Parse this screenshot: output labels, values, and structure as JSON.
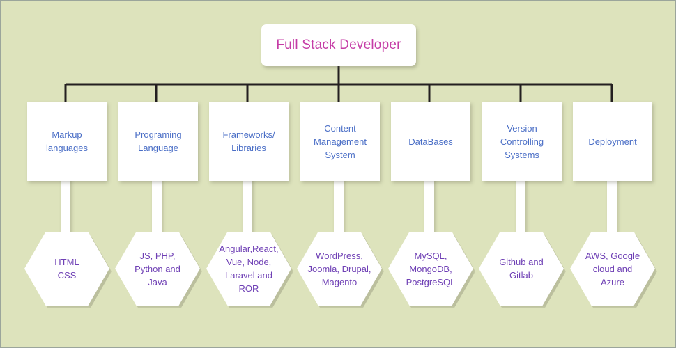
{
  "diagram": {
    "title": "Full Stack Developer",
    "background_color": "#dde3bc",
    "border_color": "#9ba59b",
    "node_fill": "#ffffff",
    "root_text_color": "#c53ca6",
    "category_text_color": "#4a6ec6",
    "leaf_text_color": "#6f40b5",
    "connector_color": "#231f20"
  },
  "root": {
    "label": "Full Stack Developer"
  },
  "categories": [
    {
      "label": "Markup\nlanguages",
      "leaf": "HTML\nCSS"
    },
    {
      "label": "Programing\nLanguage",
      "leaf": "JS, PHP,\nPython and\nJava"
    },
    {
      "label": "Frameworks/\nLibraries",
      "leaf": "Angular,React,\nVue, Node,\nLaravel and\nROR"
    },
    {
      "label": "Content\nManagement\nSystem",
      "leaf": "WordPress,\nJoomla, Drupal,\nMagento"
    },
    {
      "label": "DataBases",
      "leaf": "MySQL,\nMongoDB,\nPostgreSQL"
    },
    {
      "label": "Version\nControlling\nSystems",
      "leaf": "Github and\nGitlab"
    },
    {
      "label": "Deployment",
      "leaf": "AWS, Google\ncloud and\nAzure"
    }
  ]
}
